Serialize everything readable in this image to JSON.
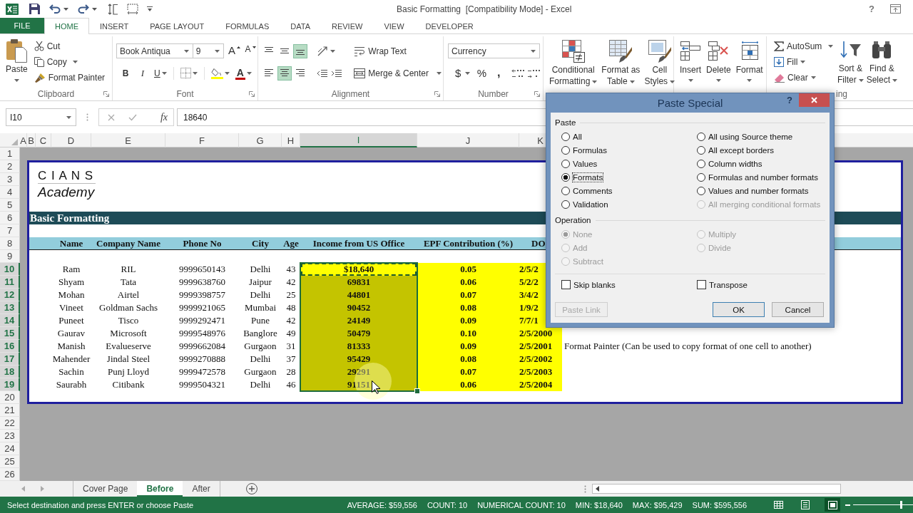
{
  "window": {
    "title": "Basic Formatting  [Compatibility Mode] - Excel",
    "help": "?"
  },
  "ribbon_tabs": [
    {
      "label": "FILE",
      "kind": "file",
      "selected": false
    },
    {
      "label": "HOME",
      "kind": "tab",
      "selected": true
    },
    {
      "label": "INSERT",
      "kind": "tab",
      "selected": false
    },
    {
      "label": "PAGE LAYOUT",
      "kind": "tab",
      "selected": false
    },
    {
      "label": "FORMULAS",
      "kind": "tab",
      "selected": false
    },
    {
      "label": "DATA",
      "kind": "tab",
      "selected": false
    },
    {
      "label": "REVIEW",
      "kind": "tab",
      "selected": false
    },
    {
      "label": "VIEW",
      "kind": "tab",
      "selected": false
    },
    {
      "label": "DEVELOPER",
      "kind": "tab",
      "selected": false
    }
  ],
  "ribbon": {
    "clipboard": {
      "label": "Clipboard",
      "paste": "Paste",
      "cut": "Cut",
      "copy": "Copy",
      "format_painter": "Format Painter"
    },
    "font": {
      "label": "Font",
      "font_name": "Book Antiqua",
      "font_size": "9",
      "grow": "A",
      "shrink": "A",
      "bold": "B",
      "italic": "I",
      "underline": "U",
      "font_color": "A"
    },
    "alignment": {
      "label": "Alignment",
      "vertical": [
        {
          "kind": "top",
          "selected": false
        },
        {
          "kind": "middle",
          "selected": false
        },
        {
          "kind": "bottom",
          "selected": true
        }
      ],
      "horizontal": [
        {
          "kind": "left",
          "selected": false
        },
        {
          "kind": "center",
          "selected": true
        },
        {
          "kind": "right",
          "selected": false
        }
      ],
      "wrap_text": "Wrap Text",
      "merge_center": "Merge & Center"
    },
    "number": {
      "label": "Number",
      "format": "Currency",
      "currency": "$",
      "percent": "%",
      "comma": ","
    },
    "styles": [
      {
        "kind": "conditional",
        "label": "Conditional\nFormatting"
      },
      {
        "kind": "table",
        "label": "Format as\nTable"
      },
      {
        "kind": "cell",
        "label": "Cell\nStyles"
      }
    ],
    "cells": [
      {
        "kind": "insert",
        "label": "Insert"
      },
      {
        "kind": "delete",
        "label": "Delete"
      },
      {
        "kind": "format",
        "label": "Format"
      }
    ],
    "editing": {
      "label": "ing",
      "autosum": "AutoSum",
      "fill": "Fill",
      "clear": "Clear",
      "sort_filter": "Sort &\nFilter",
      "find_select": "Find &\nSelect"
    }
  },
  "formula_bar": {
    "name_box": "I10",
    "function": "fx",
    "formula": "18640"
  },
  "sheet": {
    "columns": [
      {
        "label": "A",
        "selected": false
      },
      {
        "label": "B",
        "selected": false
      },
      {
        "label": "C",
        "selected": false
      },
      {
        "label": "D",
        "selected": false
      },
      {
        "label": "E",
        "selected": false
      },
      {
        "label": "F",
        "selected": false
      },
      {
        "label": "G",
        "selected": false
      },
      {
        "label": "H",
        "selected": false
      },
      {
        "label": "I",
        "selected": true
      },
      {
        "label": "J",
        "selected": false
      },
      {
        "label": "K",
        "selected": false
      }
    ],
    "rows": [
      {
        "label": "1",
        "selected": false
      },
      {
        "label": "2",
        "selected": false
      },
      {
        "label": "3",
        "selected": false
      },
      {
        "label": "4",
        "selected": false
      },
      {
        "label": "5",
        "selected": false
      },
      {
        "label": "6",
        "selected": false
      },
      {
        "label": "7",
        "selected": false
      },
      {
        "label": "8",
        "selected": false
      },
      {
        "label": "9",
        "selected": false
      },
      {
        "label": "10",
        "selected": true
      },
      {
        "label": "11",
        "selected": true
      },
      {
        "label": "12",
        "selected": true
      },
      {
        "label": "13",
        "selected": true
      },
      {
        "label": "14",
        "selected": true
      },
      {
        "label": "15",
        "selected": true
      },
      {
        "label": "16",
        "selected": true
      },
      {
        "label": "17",
        "selected": true
      },
      {
        "label": "18",
        "selected": true
      },
      {
        "label": "19",
        "selected": true
      },
      {
        "label": "20",
        "selected": false
      },
      {
        "label": "21",
        "selected": false
      },
      {
        "label": "22",
        "selected": false
      },
      {
        "label": "23",
        "selected": false
      },
      {
        "label": "24",
        "selected": false
      },
      {
        "label": "25",
        "selected": false
      },
      {
        "label": "26",
        "selected": false
      }
    ],
    "logo": {
      "name": "C I A N S",
      "tagline": "Academy"
    },
    "section_title": "Basic Formatting",
    "table": {
      "columns": [
        {
          "label": "Name",
          "highlighted": false
        },
        {
          "label": "Company Name",
          "highlighted": false
        },
        {
          "label": "Phone No",
          "highlighted": false
        },
        {
          "label": "City",
          "highlighted": false
        },
        {
          "label": "Age",
          "highlighted": false
        },
        {
          "label": "Income from US Office",
          "highlighted": true
        },
        {
          "label": "EPF Contribution (%)",
          "highlighted": true
        },
        {
          "label": "DO",
          "highlighted": true
        }
      ],
      "rows": [
        {
          "cells": [
            "Ram",
            "RIL",
            "9999650143",
            "Delhi",
            "43",
            "$18,640",
            "0.05",
            "2/5/2"
          ],
          "selected": false,
          "copied": true
        },
        {
          "cells": [
            "Shyam",
            "Tata",
            "9999638760",
            "Jaipur",
            "42",
            "69831",
            "0.06",
            "5/2/2"
          ],
          "selected": true,
          "copied": false
        },
        {
          "cells": [
            "Mohan",
            "Airtel",
            "9999398757",
            "Delhi",
            "25",
            "44801",
            "0.07",
            "3/4/2"
          ],
          "selected": true,
          "copied": false
        },
        {
          "cells": [
            "Vineet",
            "Goldman Sachs",
            "9999921065",
            "Mumbai",
            "48",
            "90452",
            "0.08",
            "1/9/2"
          ],
          "selected": true,
          "copied": false
        },
        {
          "cells": [
            "Puneet",
            "Tisco",
            "9999292471",
            "Pune",
            "42",
            "24149",
            "0.09",
            "7/7/1"
          ],
          "selected": true,
          "copied": false
        },
        {
          "cells": [
            "Gaurav",
            "Microsoft",
            "9999548976",
            "Banglore",
            "49",
            "50479",
            "0.10",
            "2/5/2000"
          ],
          "selected": true,
          "copied": false
        },
        {
          "cells": [
            "Manish",
            "Evalueserve",
            "9999662084",
            "Gurgaon",
            "31",
            "81333",
            "0.09",
            "2/5/2001"
          ],
          "selected": true,
          "copied": false,
          "note": "Format Painter (Can be used to copy format of one cell to another)"
        },
        {
          "cells": [
            "Mahender",
            "Jindal Steel",
            "9999270888",
            "Delhi",
            "37",
            "95429",
            "0.08",
            "2/5/2002"
          ],
          "selected": true,
          "copied": false
        },
        {
          "cells": [
            "Sachin",
            "Punj Lloyd",
            "9999472578",
            "Gurgaon",
            "28",
            "29291",
            "0.07",
            "2/5/2003"
          ],
          "selected": true,
          "copied": false
        },
        {
          "cells": [
            "Saurabh",
            "Citibank",
            "9999504321",
            "Delhi",
            "46",
            "91151",
            "0.06",
            "2/5/2004"
          ],
          "selected": true,
          "copied": false
        }
      ]
    }
  },
  "dialog": {
    "title": "Paste Special",
    "help": "?",
    "paste_label": "Paste",
    "paste_options": [
      {
        "label": "All",
        "selected": false,
        "disabled": false
      },
      {
        "label": "Formulas",
        "selected": false,
        "disabled": false
      },
      {
        "label": "Values",
        "selected": false,
        "disabled": false
      },
      {
        "label": "Formats",
        "selected": true,
        "disabled": false
      },
      {
        "label": "Comments",
        "selected": false,
        "disabled": false
      },
      {
        "label": "Validation",
        "selected": false,
        "disabled": false
      },
      {
        "label": "All using Source theme",
        "selected": false,
        "disabled": false
      },
      {
        "label": "All except borders",
        "selected": false,
        "disabled": false
      },
      {
        "label": "Column widths",
        "selected": false,
        "disabled": false
      },
      {
        "label": "Formulas and number formats",
        "selected": false,
        "disabled": false
      },
      {
        "label": "Values and number formats",
        "selected": false,
        "disabled": false
      },
      {
        "label": "All merging conditional formats",
        "selected": false,
        "disabled": true
      }
    ],
    "operation_label": "Operation",
    "operations": [
      {
        "label": "None",
        "selected": true,
        "disabled": true
      },
      {
        "label": "Add",
        "selected": false,
        "disabled": true
      },
      {
        "label": "Subtract",
        "selected": false,
        "disabled": true
      },
      {
        "label": "Multiply",
        "selected": false,
        "disabled": true
      },
      {
        "label": "Divide",
        "selected": false,
        "disabled": true
      }
    ],
    "checkboxes": [
      {
        "label": "Skip blanks",
        "checked": false
      },
      {
        "label": "Transpose",
        "checked": false
      }
    ],
    "buttons": [
      {
        "label": "Paste Link",
        "disabled": true,
        "default": false
      },
      {
        "label": "OK",
        "disabled": false,
        "default": true
      },
      {
        "label": "Cancel",
        "disabled": false,
        "default": false
      }
    ]
  },
  "sheet_tabs": [
    {
      "label": "Cover Page",
      "selected": false
    },
    {
      "label": "Before",
      "selected": true
    },
    {
      "label": "After",
      "selected": false
    }
  ],
  "status_bar": {
    "message": "Select destination and press ENTER or choose Paste",
    "stats": [
      "AVERAGE: $59,556",
      "COUNT: 10",
      "NUMERICAL COUNT: 10",
      "MIN: $18,640",
      "MAX: $95,429",
      "SUM: $595,556"
    ],
    "views": [
      {
        "kind": "normal",
        "selected": false
      },
      {
        "kind": "page_layout",
        "selected": false
      },
      {
        "kind": "page_break",
        "selected": true
      }
    ],
    "zoom": {
      "level": 0.8
    }
  }
}
